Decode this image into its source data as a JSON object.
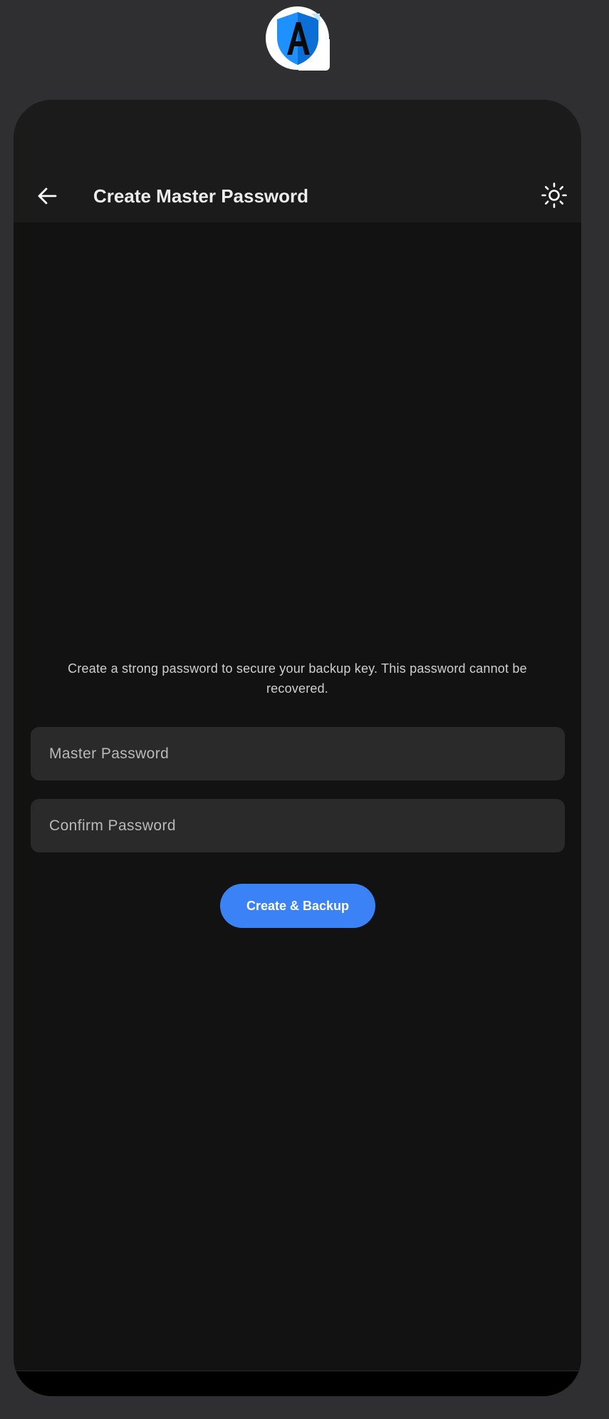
{
  "app": {
    "logo_icon": "shield-letter-a-icon"
  },
  "app_bar": {
    "title": "Create Master Password",
    "back_icon": "arrow-left-icon",
    "theme_icon": "sun-icon"
  },
  "main": {
    "description": "Create a strong password to secure your backup key. This password cannot be recovered.",
    "master_password": {
      "placeholder": "Master Password",
      "value": ""
    },
    "confirm_password": {
      "placeholder": "Confirm Password",
      "value": ""
    },
    "submit_label": "Create & Backup"
  },
  "colors": {
    "background": "#2f2f31",
    "surface": "#121212",
    "app_bar": "#1b1b1c",
    "field": "#2a2a2b",
    "accent": "#3b82f6"
  }
}
